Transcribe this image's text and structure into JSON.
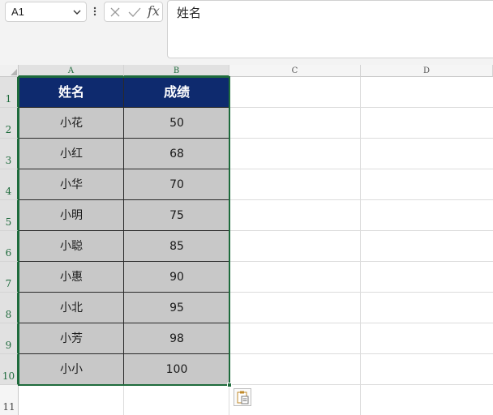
{
  "name_box": {
    "value": "A1"
  },
  "formula_bar": {
    "fx_label": "fx",
    "content": "姓名"
  },
  "columns": [
    "A",
    "B",
    "C",
    "D"
  ],
  "rows": [
    "1",
    "2",
    "3",
    "4",
    "5",
    "6",
    "7",
    "8",
    "9",
    "10",
    "11"
  ],
  "table": {
    "headers": [
      "姓名",
      "成绩"
    ],
    "rows": [
      [
        "小花",
        "50"
      ],
      [
        "小红",
        "68"
      ],
      [
        "小华",
        "70"
      ],
      [
        "小明",
        "75"
      ],
      [
        "小聪",
        "85"
      ],
      [
        "小惠",
        "90"
      ],
      [
        "小北",
        "95"
      ],
      [
        "小芳",
        "98"
      ],
      [
        "小小",
        "100"
      ]
    ]
  },
  "colors": {
    "header_fill": "#0e2a6e",
    "data_fill": "#c8c8c8",
    "selection": "#1e6b3c"
  },
  "icons": [
    "chevron-down-icon",
    "more-vertical-icon",
    "cancel-icon",
    "confirm-icon",
    "paste-options-icon"
  ]
}
